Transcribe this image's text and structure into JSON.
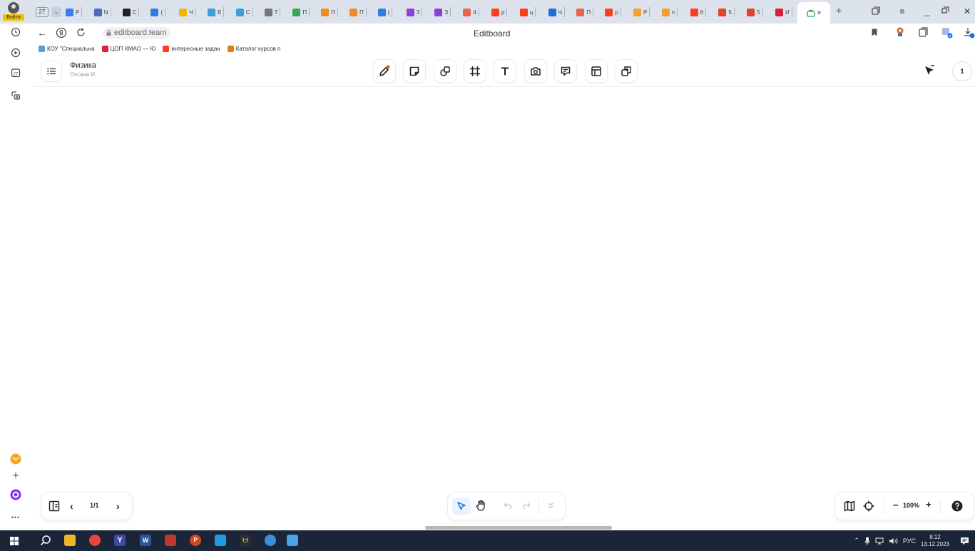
{
  "browser": {
    "login_label": "Войти",
    "tab_count": "27",
    "tabs": [
      {
        "letter": "Р",
        "icon": "chrome-icon",
        "color": "#3b7cf0"
      },
      {
        "letter": "N",
        "icon": "app-icon",
        "color": "#4a6fb8"
      },
      {
        "letter": "С",
        "icon": "circle-icon",
        "color": "#222222"
      },
      {
        "letter": "(",
        "icon": "mail-icon",
        "color": "#2f7de1"
      },
      {
        "letter": "Ч",
        "icon": "smile-icon",
        "color": "#f2b705"
      },
      {
        "letter": "В",
        "icon": "school-icon",
        "color": "#3aa0d8"
      },
      {
        "letter": "С",
        "icon": "school-icon",
        "color": "#3aa0d8"
      },
      {
        "letter": "Т",
        "icon": "doc-icon",
        "color": "#777777"
      },
      {
        "letter": "П",
        "icon": "drive-icon",
        "color": "#34a853"
      },
      {
        "letter": "П",
        "icon": "cloud-icon",
        "color": "#f08a24"
      },
      {
        "letter": "П",
        "icon": "cloud-icon",
        "color": "#f08a24"
      },
      {
        "letter": "(",
        "icon": "mail-icon",
        "color": "#2f7de1"
      },
      {
        "letter": "З",
        "icon": "y-icon",
        "color": "#8e3fd6"
      },
      {
        "letter": "З",
        "icon": "y-icon",
        "color": "#8e3fd6"
      },
      {
        "letter": "4",
        "icon": "doc-icon",
        "color": "#e8654a"
      },
      {
        "letter": "р",
        "icon": "yandex-icon",
        "color": "#fc3f1d"
      },
      {
        "letter": "ц",
        "icon": "yandex-icon",
        "color": "#fc3f1d"
      },
      {
        "letter": "Ч",
        "icon": "wave-icon",
        "color": "#1c6fd4"
      },
      {
        "letter": "П",
        "icon": "doc-icon",
        "color": "#e8654a"
      },
      {
        "letter": "р",
        "icon": "yandex-icon",
        "color": "#fc3f1d"
      },
      {
        "letter": "Р",
        "icon": "sun-icon",
        "color": "#f59e2c"
      },
      {
        "letter": "п",
        "icon": "sun-icon",
        "color": "#f59e2c"
      },
      {
        "letter": "6",
        "icon": "yandex-icon",
        "color": "#fc3f1d"
      },
      {
        "letter": "5",
        "icon": "chart-icon",
        "color": "#e0442b"
      },
      {
        "letter": "5",
        "icon": "chart-icon",
        "color": "#e0442b"
      },
      {
        "letter": "И",
        "icon": "b-icon",
        "color": "#d8213c"
      }
    ],
    "active_tab_close": "×",
    "url": "editboard.team",
    "page_title": "Editboard",
    "bookmarks": [
      {
        "label": "КОУ \"Специальна",
        "icon": "school-icon",
        "color": "#5a9ad6"
      },
      {
        "label": "ЦОП ХМАО — Ю",
        "icon": "b-icon",
        "color": "#d8213c"
      },
      {
        "label": "интересные задан",
        "icon": "yandex-icon",
        "color": "#fc3f1d"
      },
      {
        "label": "Каталог курсов п",
        "icon": "feather-icon",
        "color": "#e07b18"
      }
    ]
  },
  "board": {
    "name": "Физика",
    "owner": "Оксана И",
    "participants": "1"
  },
  "pages": {
    "indicator": "1/1"
  },
  "zoom": {
    "level": "100%",
    "minus": "−",
    "plus": "+"
  },
  "taskbar": {
    "lang": "РУС",
    "time": "8:12",
    "date": "13.12.2023"
  }
}
